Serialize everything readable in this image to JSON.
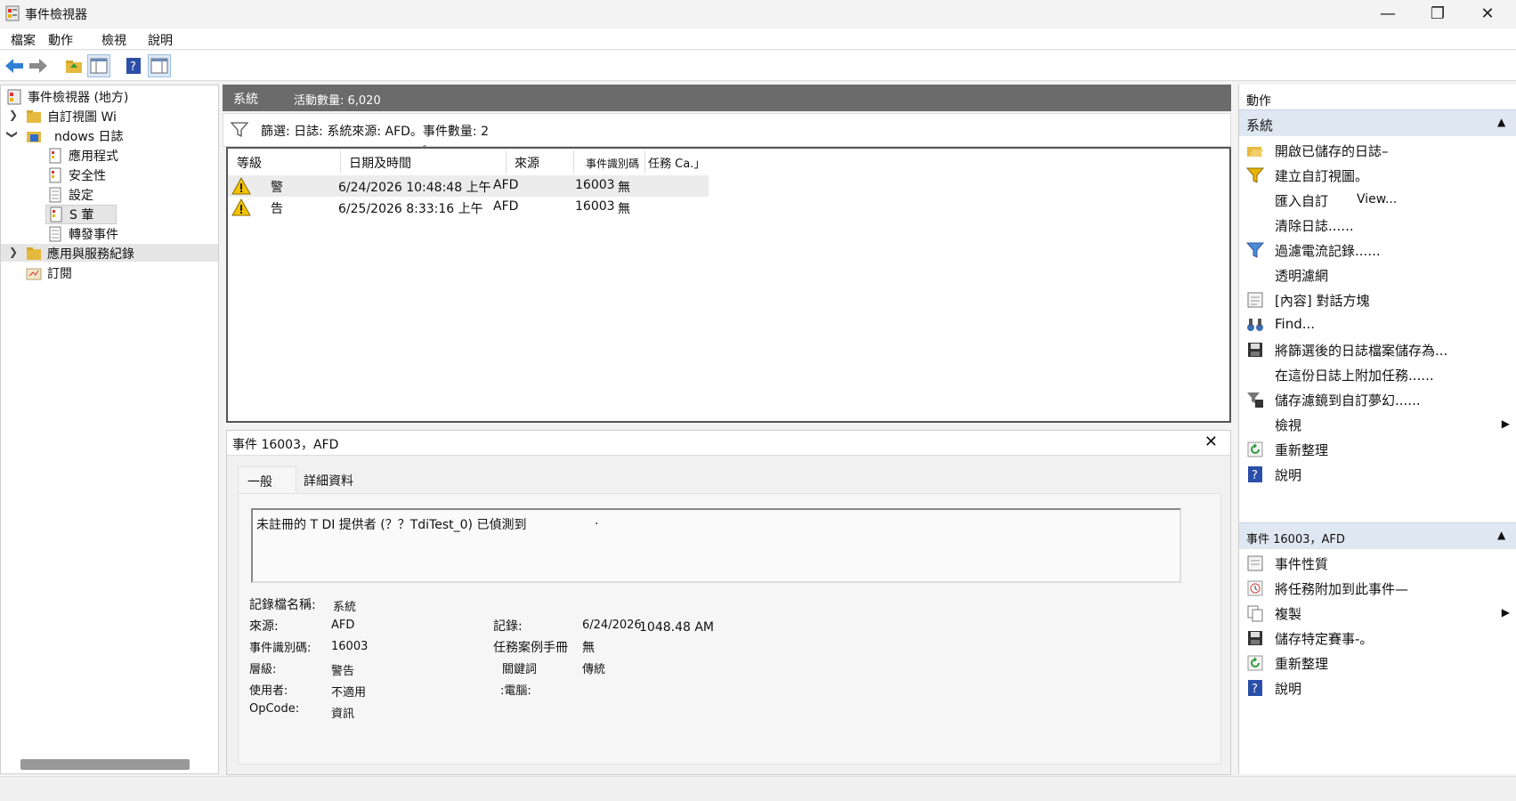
{
  "window": {
    "title": "事件檢視器"
  },
  "menu": [
    "檔案",
    "動作",
    "檢視",
    "說明"
  ],
  "tree": {
    "root": "事件檢視器 (地方)",
    "custom_views": "自訂視圖 Wi",
    "windows_logs": "ndows 日誌",
    "children": [
      "應用程式",
      "安全性",
      "設定",
      "S 葷",
      "轉發事件"
    ],
    "app_services": "應用與服務紀錄",
    "subscriptions": "訂閱"
  },
  "center": {
    "header_title": "系統",
    "header_count": "活動數量: 6,020",
    "filter_text": "篩選: 日誌: 系統來源: AFD。事件數量: 2",
    "columns": [
      "等級",
      "日期及時間",
      "來源",
      "事件識別碼",
      "任務 Ca.」"
    ],
    "rows": [
      {
        "level": "警",
        "datetime": "6/24/2026 10:48:48 上午",
        "source": "AFD",
        "id": "16003",
        "task": "無"
      },
      {
        "level": "告",
        "datetime": "6/25/2026 8:33:16 上午",
        "source": "AFD",
        "id": "16003",
        "task": "無"
      }
    ]
  },
  "detail": {
    "title": "事件 16003，AFD",
    "tabs": [
      "一般",
      "詳細資料"
    ],
    "description": "未註冊的 T DI 提供者 (？？TdiTest_0) 已偵測到",
    "cursor": ".",
    "fields": {
      "log_name_label": "記錄檔名稱:",
      "log_name": "系統",
      "source_label": "來源:",
      "source": "AFD",
      "logged_label": "記錄:",
      "logged_date": "6/24/2026",
      "logged_time": "1048.48 AM",
      "event_id_label": "事件識別碼:",
      "event_id": "16003",
      "task_label": "任務案例手冊",
      "task": "無",
      "level_label": "層級:",
      "level": "警告",
      "keywords_label": "關鍵詞",
      "keywords": "傳統",
      "user_label": "使用者:",
      "user": "不適用",
      "computer_label": ":電腦:",
      "opcode_label": "OpCode:",
      "opcode": "資訊"
    }
  },
  "actions": {
    "header": "動作",
    "section1": "系統",
    "items1": [
      "開啟已儲存的日誌–",
      "建立自訂視圖。",
      "匯入自訂",
      "View...",
      "清除日誌......",
      "過濾電流記錄......",
      "透明濾網",
      "[內容] 對話方塊",
      "Find...",
      "將篩選後的日誌檔案儲存為...",
      "在這份日誌上附加任務......",
      "儲存濾鏡到自訂夢幻......",
      "檢視",
      "重新整理",
      "說明"
    ],
    "section2": "事件 16003，AFD",
    "items2": [
      "事件性質",
      "將任務附加到此事件—",
      "複製",
      "儲存特定賽事-。",
      "重新整理",
      "說明"
    ]
  },
  "colors": {
    "header_gray": "#6b6b6b",
    "section_blue": "#dfe8f2",
    "warning_yellow": "#f2c200",
    "help_blue": "#2b4fa8"
  }
}
